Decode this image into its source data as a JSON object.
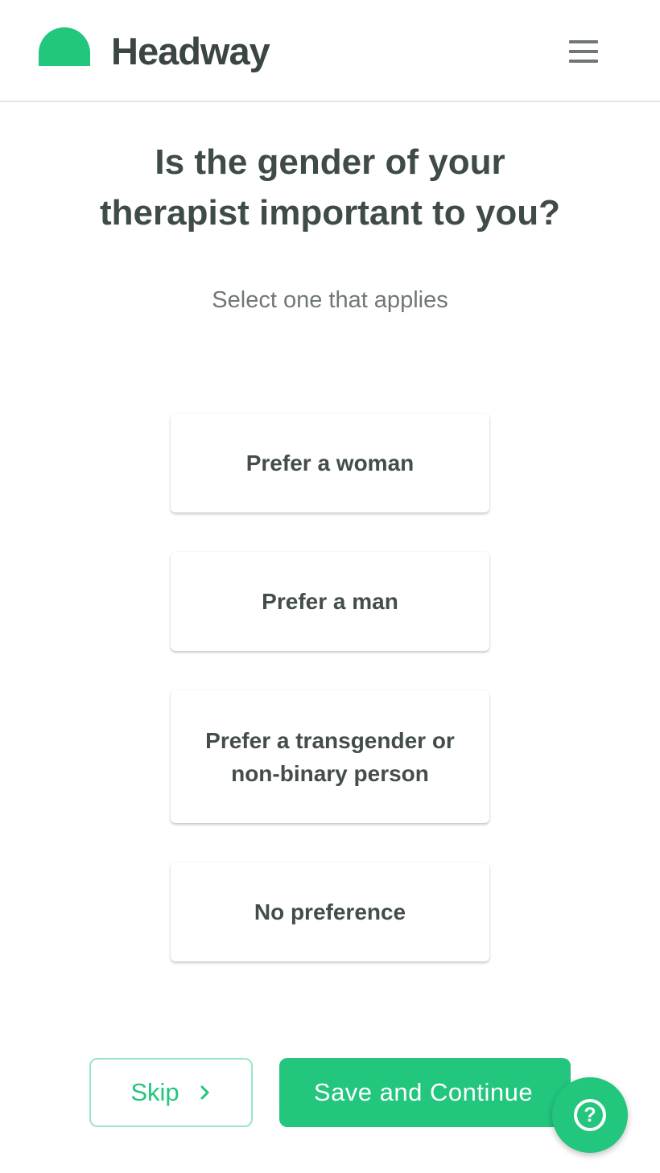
{
  "header": {
    "logo_text": "Headway",
    "menu_icon": "hamburger-menu-icon"
  },
  "question": {
    "title_line1": "Is the gender of your",
    "title_line2": "therapist important to you?",
    "subtitle": "Select one that applies"
  },
  "options": [
    {
      "label": "Prefer a woman"
    },
    {
      "label": "Prefer a man"
    },
    {
      "label": "Prefer a transgender or non-binary person"
    },
    {
      "label": "No preference"
    }
  ],
  "footer": {
    "skip_label": "Skip",
    "skip_icon": "chevron-right-icon",
    "save_label": "Save and Continue",
    "help_icon": "question-circle-icon",
    "help_glyph": "?"
  },
  "colors": {
    "brand_green": "#22c67d",
    "text_dark": "#3f4b46",
    "text_muted": "#707874"
  }
}
